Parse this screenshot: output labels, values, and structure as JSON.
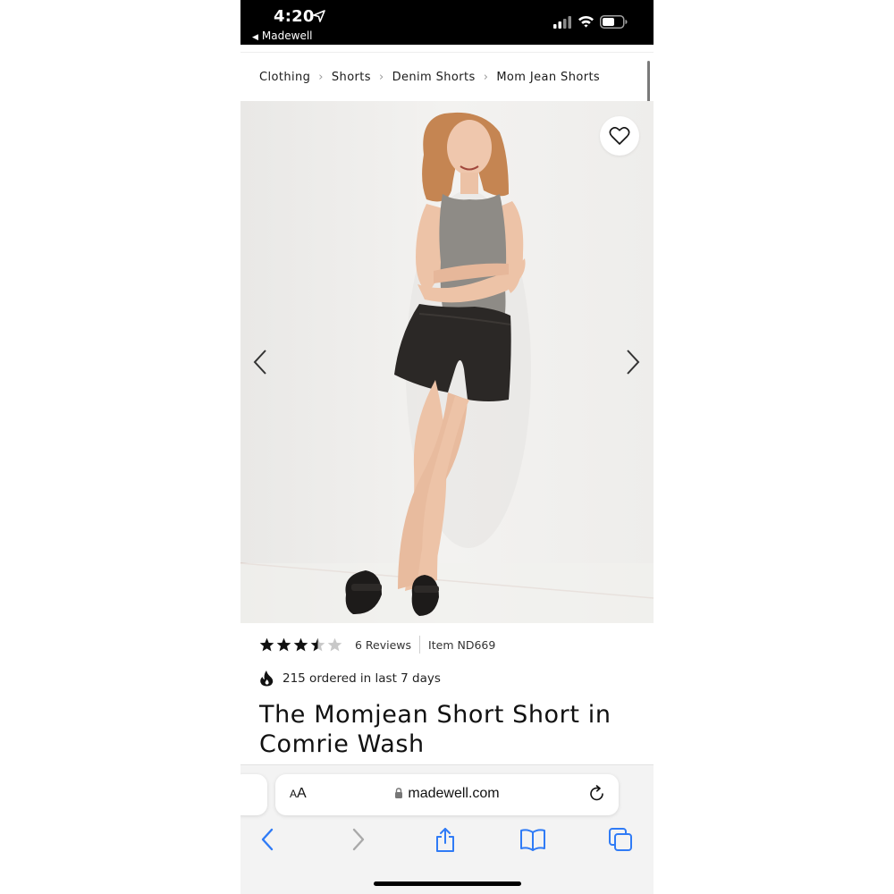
{
  "status_bar": {
    "time": "4:20",
    "back_app": "Madewell"
  },
  "breadcrumb": {
    "items": [
      "Clothing",
      "Shorts",
      "Denim Shorts",
      "Mom Jean Shorts"
    ]
  },
  "product": {
    "rating": 3.5,
    "rating_max": 5,
    "reviews_label": "6 Reviews",
    "item_number": "Item ND669",
    "ordered_text": "215 ordered in last 7 days",
    "title": "The Momjean Short Short in Comrie Wash"
  },
  "browser": {
    "text_size_small": "A",
    "text_size_large": "A",
    "url": "madewell.com"
  },
  "icons": {
    "wishlist": "heart-icon",
    "prev": "chevron-left-icon",
    "next": "chevron-right-icon",
    "fire": "fire-icon",
    "lock": "lock-icon",
    "reload": "reload-icon",
    "back": "back-arrow-icon",
    "forward": "forward-arrow-icon",
    "share": "share-icon",
    "bookmarks": "bookmarks-icon",
    "tabs": "tabs-icon"
  },
  "colors": {
    "status_bar_bg": "#000000",
    "star_filled": "#111111",
    "star_empty": "#c8c8c8",
    "safari_accent": "#2f7bf6",
    "safari_disabled": "#a9a9a9"
  }
}
